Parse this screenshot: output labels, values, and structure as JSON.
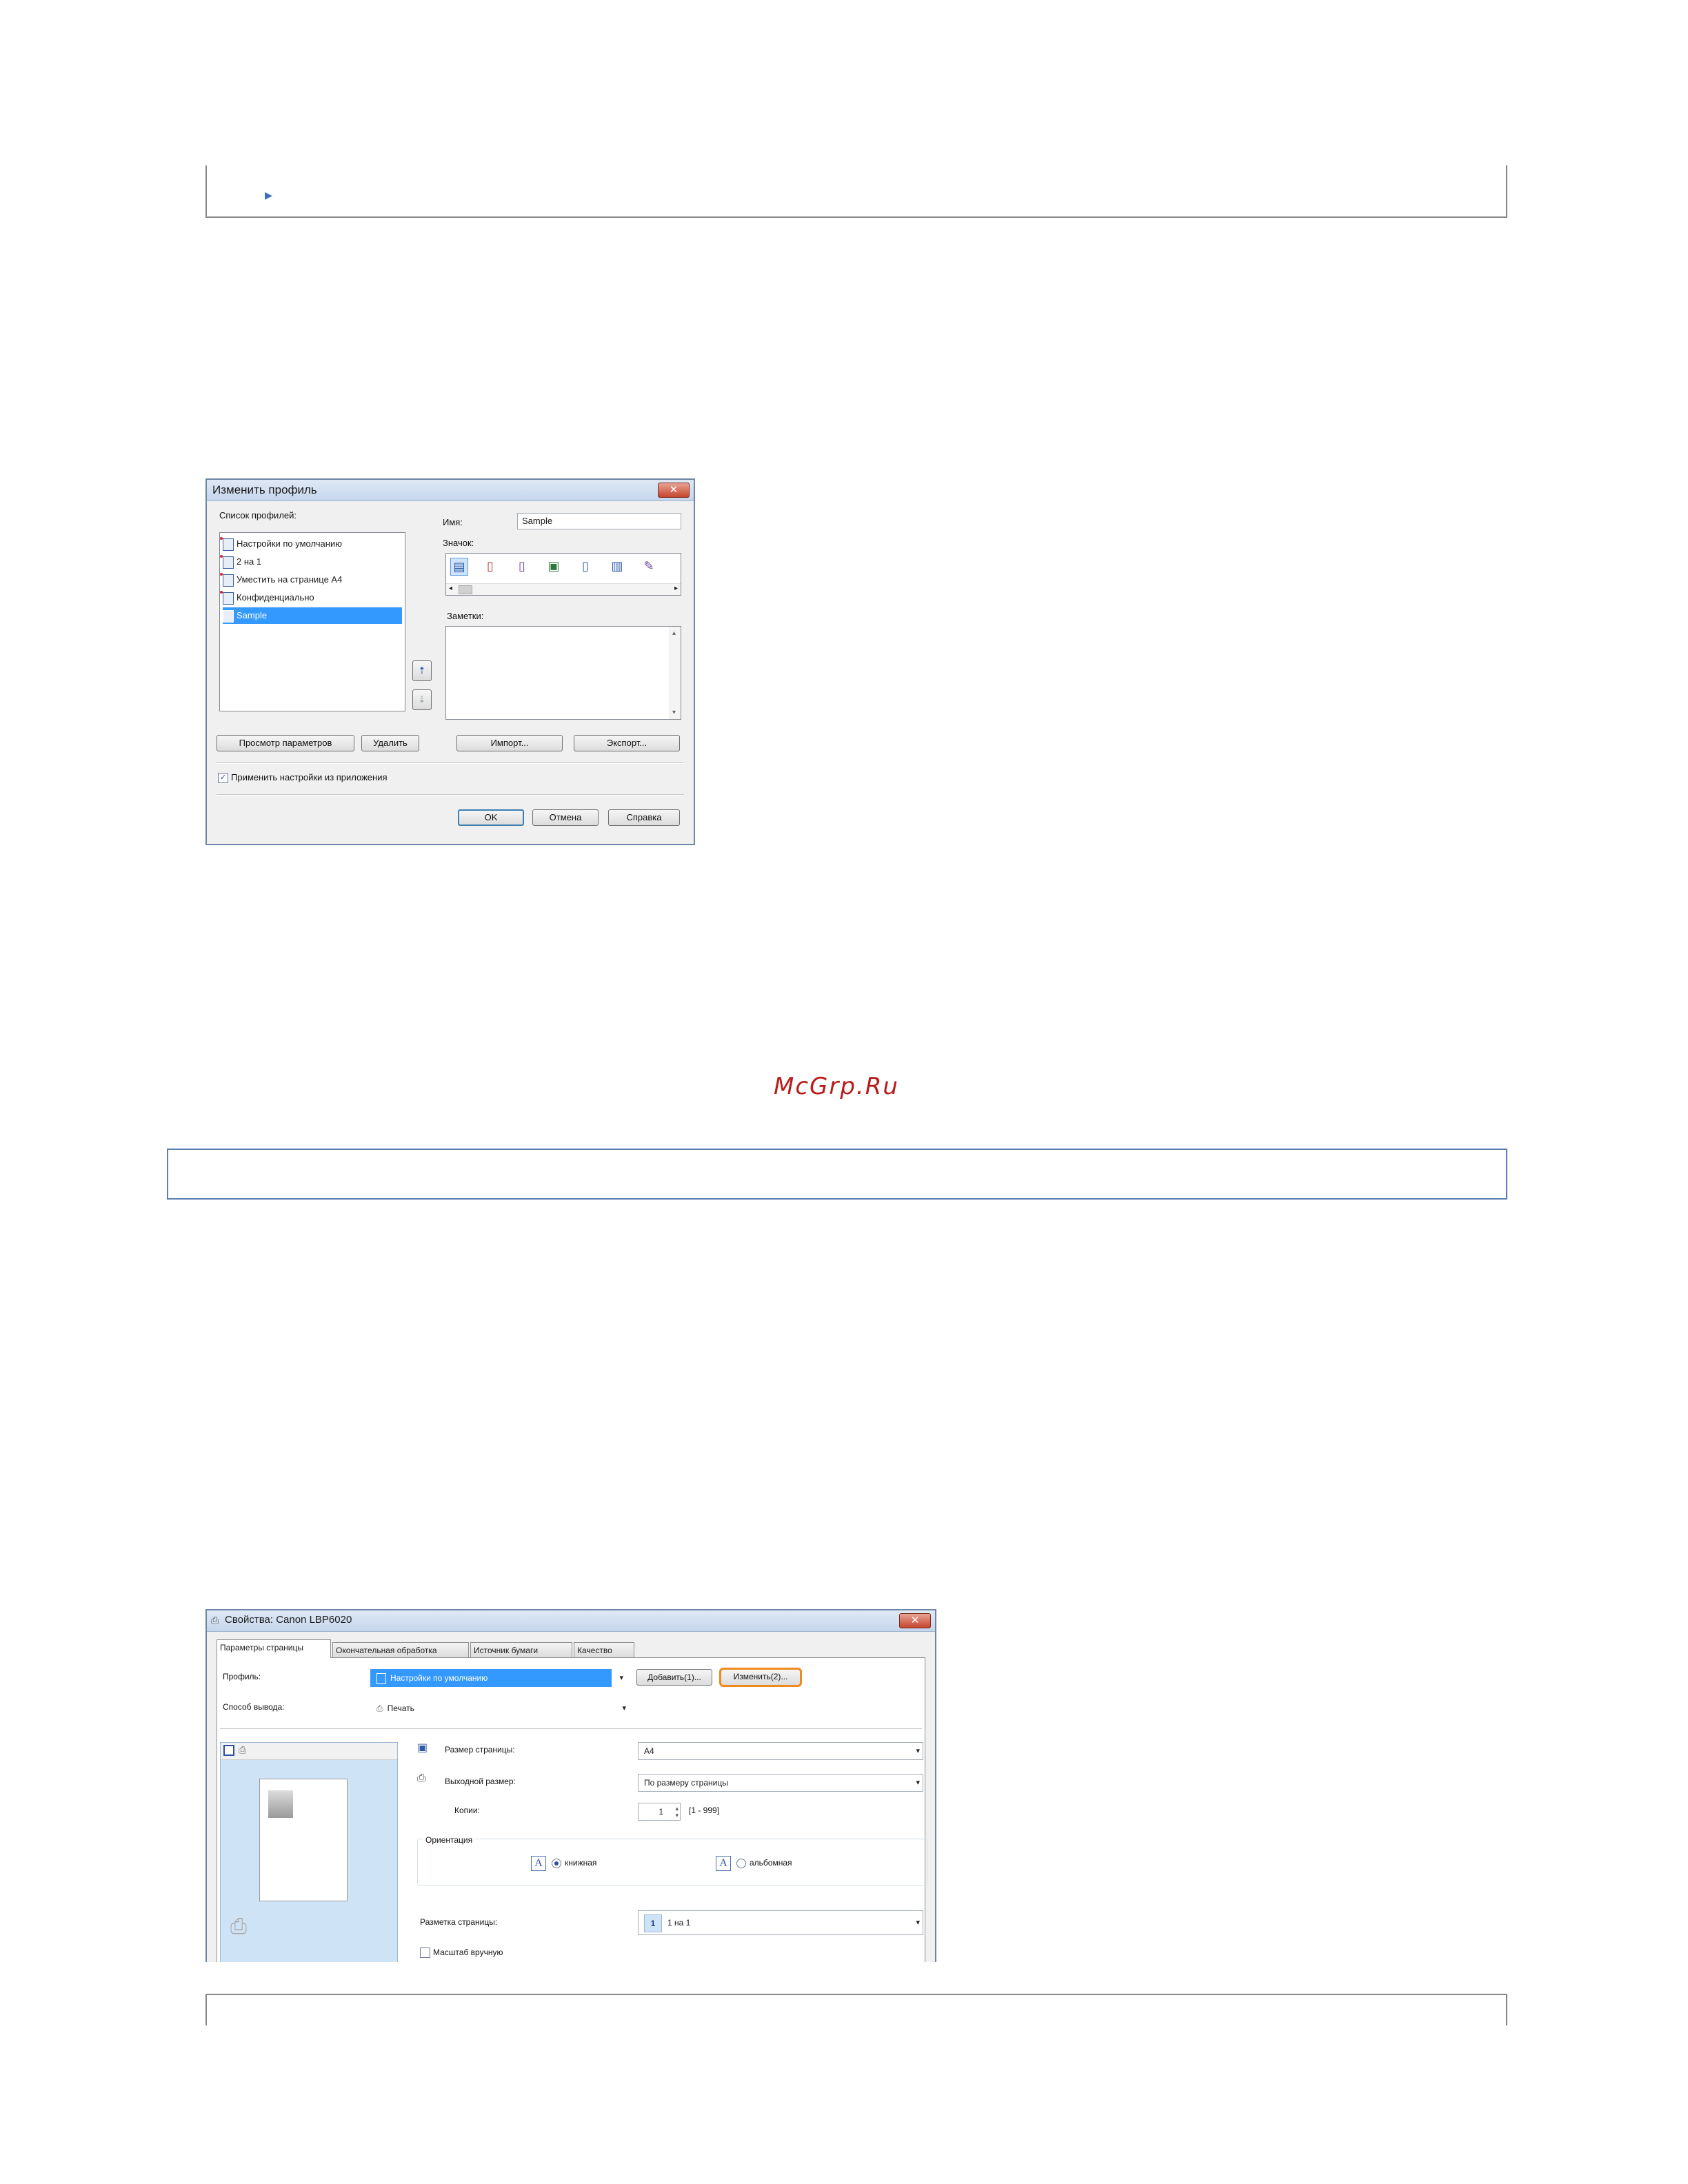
{
  "watermark": "McGrp.Ru",
  "edit_profile_dialog": {
    "title": "Изменить профиль",
    "close_glyph": "✕",
    "profile_list_label": "Список профилей:",
    "profiles": [
      {
        "label": "Настройки по умолчанию"
      },
      {
        "label": "2 на 1"
      },
      {
        "label": "Уместить на странице A4"
      },
      {
        "label": "Конфиденциально"
      },
      {
        "label": "Sample"
      }
    ],
    "selected_profile_index": 4,
    "name_label": "Имя:",
    "name_value": "Sample",
    "icon_label": "Значок:",
    "icons": [
      "page-icon",
      "page-red-icon",
      "page-blue-icon",
      "photo-icon",
      "page-small-icon",
      "book-icon",
      "pencil-icon"
    ],
    "notes_label": "Заметки:",
    "notes_value": "",
    "view_settings_button": "Просмотр параметров",
    "delete_button": "Удалить",
    "import_button": "Импорт...",
    "export_button": "Экспорт...",
    "apply_app_settings_label": "Применить настройки из приложения",
    "apply_app_settings_checked": true,
    "ok_button": "OK",
    "cancel_button": "Отмена",
    "help_button": "Справка"
  },
  "properties_window": {
    "title": "Свойства: Canon LBP6020",
    "close_glyph": "✕",
    "tabs": [
      {
        "label": "Параметры страницы"
      },
      {
        "label": "Окончательная обработка"
      },
      {
        "label": "Источник бумаги"
      },
      {
        "label": "Качество"
      }
    ],
    "profile_label": "Профиль:",
    "profile_value": "Настройки по умолчанию",
    "add_button": "Добавить(1)...",
    "edit_button": "Изменить(2)...",
    "output_method_label": "Способ вывода:",
    "output_method_value": "Печать",
    "page_size_label": "Размер страницы:",
    "page_size_value": "A4",
    "output_size_label": "Выходной размер:",
    "output_size_value": "По размеру страницы",
    "copies_label": "Копии:",
    "copies_value": "1",
    "copies_range": "[1 - 999]",
    "orientation_label": "Ориентация",
    "portrait_label": "книжная",
    "landscape_label": "альбомная",
    "orientation_selected": "portrait",
    "page_layout_label": "Разметка страницы:",
    "page_layout_value": "1 на 1",
    "page_layout_number": "1",
    "manual_scale_label": "Масштаб вручную",
    "manual_scale_checked": false,
    "letter_glyph": "A",
    "dropdown_glyph": "▾"
  }
}
